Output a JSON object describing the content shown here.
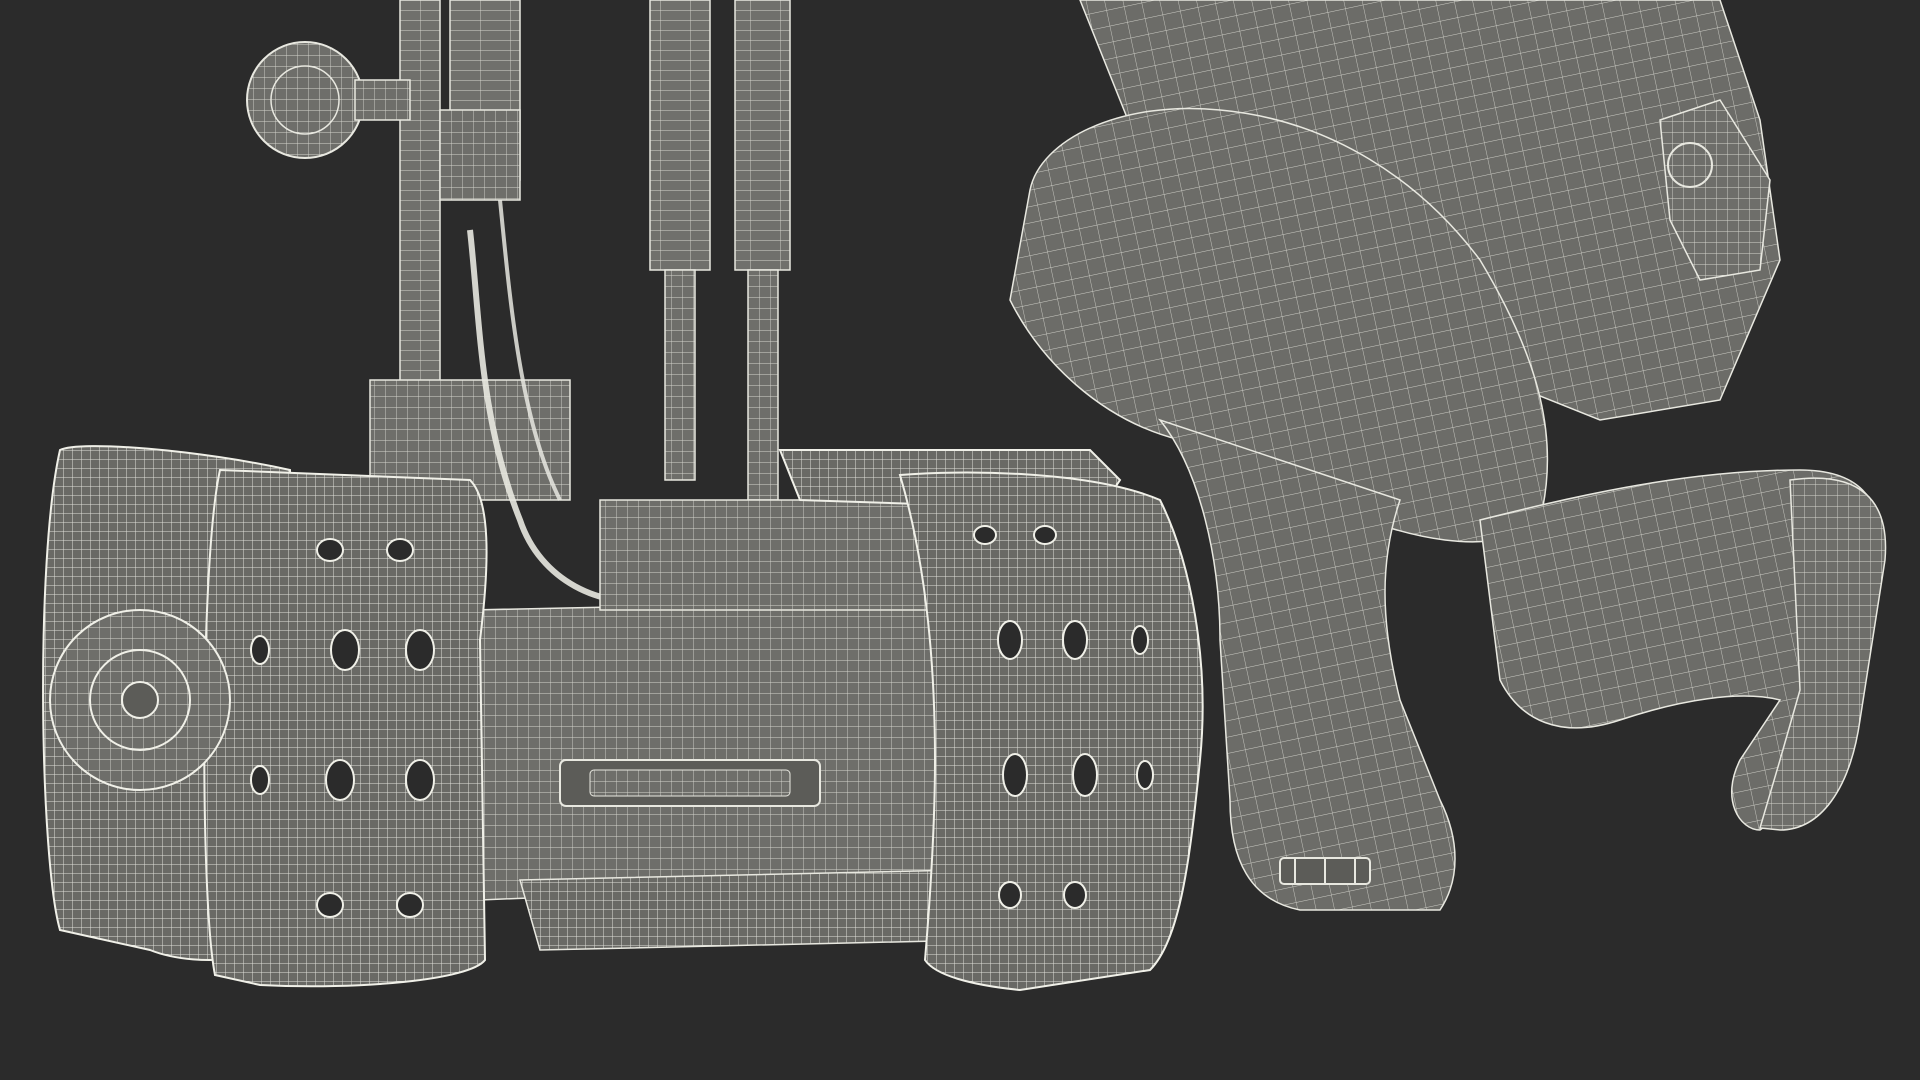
{
  "scene": {
    "background": "#2b2b2b",
    "mesh_fill": "#6e6e6a",
    "mesh_fill_dark": "#5c5c58",
    "wire_color": "#e8e8e0",
    "subject_left": "tracked-robot-wireframe",
    "subject_right": "kneeling-figure-wireframe"
  }
}
